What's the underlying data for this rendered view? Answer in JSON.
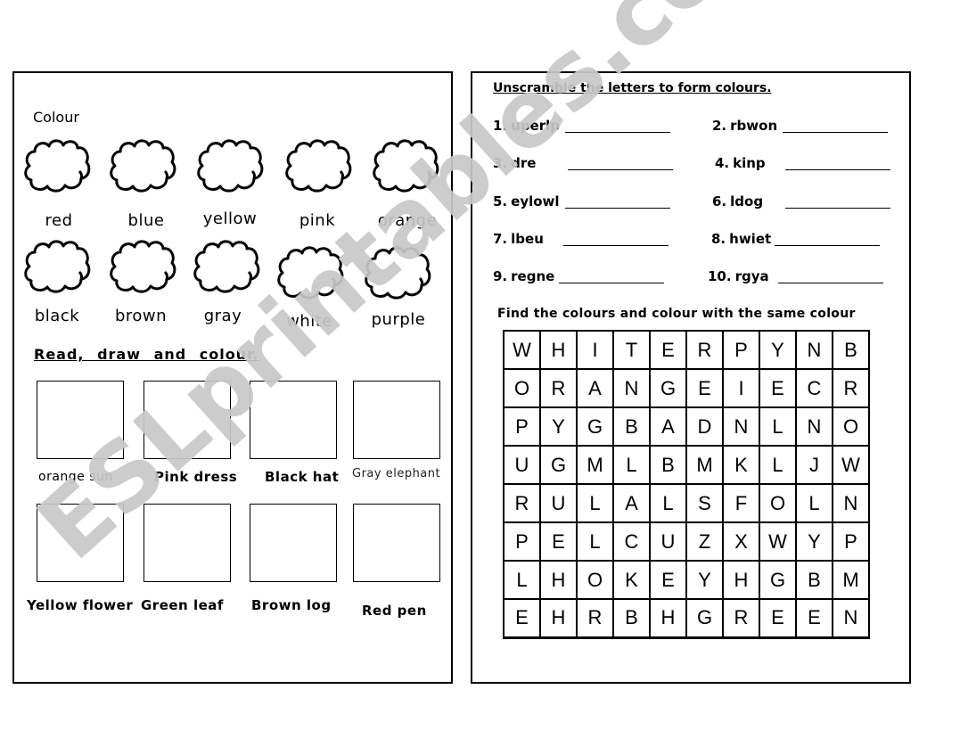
{
  "left": {
    "colour_heading": "Colour",
    "clouds": [
      {
        "label": "red"
      },
      {
        "label": "blue"
      },
      {
        "label": "yellow"
      },
      {
        "label": "pink"
      },
      {
        "label": "orange"
      },
      {
        "label": "black"
      },
      {
        "label": "brown"
      },
      {
        "label": "gray"
      },
      {
        "label": "white"
      },
      {
        "label": "purple"
      }
    ],
    "section_title": "Read, draw and colour.",
    "boxes": [
      {
        "label": "orange sun"
      },
      {
        "label": "Pink dress"
      },
      {
        "label": "Black  hat"
      },
      {
        "label": "Gray elephant"
      },
      {
        "label": "Yellow flower"
      },
      {
        "label": "Green leaf"
      },
      {
        "label": "Brown log"
      },
      {
        "label": "Red pen"
      }
    ]
  },
  "right": {
    "unscramble_title": "Unscramble the letters to form colours.",
    "questions": [
      {
        "num": "1.",
        "word": "uperlp"
      },
      {
        "num": "2.",
        "word": "rbwon"
      },
      {
        "num": "3.",
        "word": "dre"
      },
      {
        "num": "4.",
        "word": "kinp"
      },
      {
        "num": "5.",
        "word": "eylowl"
      },
      {
        "num": "6.",
        "word": "ldog"
      },
      {
        "num": "7.",
        "word": "lbeu"
      },
      {
        "num": "8.",
        "word": "hwiet"
      },
      {
        "num": "9.",
        "word": "regne"
      },
      {
        "num": "10.",
        "word": "rgya"
      }
    ],
    "find_title": "Find the colours and colour with the same colour",
    "grid": [
      [
        "W",
        "H",
        "I",
        "T",
        "E",
        "R",
        "P",
        "Y",
        "N",
        "B"
      ],
      [
        "O",
        "R",
        "A",
        "N",
        "G",
        "E",
        "I",
        "E",
        "C",
        "R"
      ],
      [
        "P",
        "Y",
        "G",
        "B",
        "A",
        "D",
        "N",
        "L",
        "N",
        "O"
      ],
      [
        "U",
        "G",
        "M",
        "L",
        "B",
        "M",
        "K",
        "L",
        "J",
        "W"
      ],
      [
        "R",
        "U",
        "L",
        "A",
        "L",
        "S",
        "F",
        "O",
        "L",
        "N"
      ],
      [
        "P",
        "E",
        "L",
        "C",
        "U",
        "Z",
        "X",
        "W",
        "Y",
        "P"
      ],
      [
        "L",
        "H",
        "O",
        "K",
        "E",
        "Y",
        "H",
        "G",
        "B",
        "M"
      ],
      [
        "E",
        "H",
        "R",
        "B",
        "H",
        "G",
        "R",
        "E",
        "E",
        "N"
      ]
    ]
  },
  "watermark": "ESLprintables.com"
}
